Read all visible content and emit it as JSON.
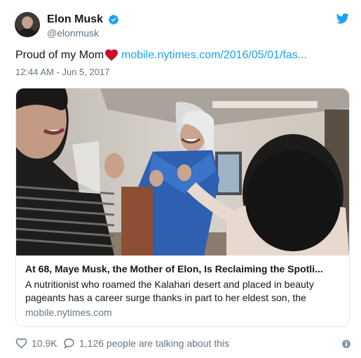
{
  "tweet": {
    "author": {
      "name": "Elon Musk",
      "handle": "@elonmusk",
      "verified": true
    },
    "text": "Proud of my Mom",
    "emoji": "red-heart-icon",
    "link_text": "mobile.nytimes.com/2016/05/01/fas...",
    "timestamp": "12:44 AM - Jun 5, 2017",
    "card": {
      "title": "At 68, Maye Musk, the Mother of Elon, Is Reclaiming the Spotli...",
      "description": "A nutritionist who roamed the Kalahari desert and placed in beauty pageants has a career surge thanks in part to her eldest son, the",
      "domain": "mobile.nytimes.com"
    },
    "actions": {
      "likes": "10.9K",
      "talking": "1,126 people are talking about this"
    }
  },
  "colors": {
    "twitter_blue": "#1da1f2",
    "verified_blue": "#1da1f2",
    "heart_red": "#c8102e",
    "secondary_text": "#657786",
    "primary_text": "#14171a"
  }
}
